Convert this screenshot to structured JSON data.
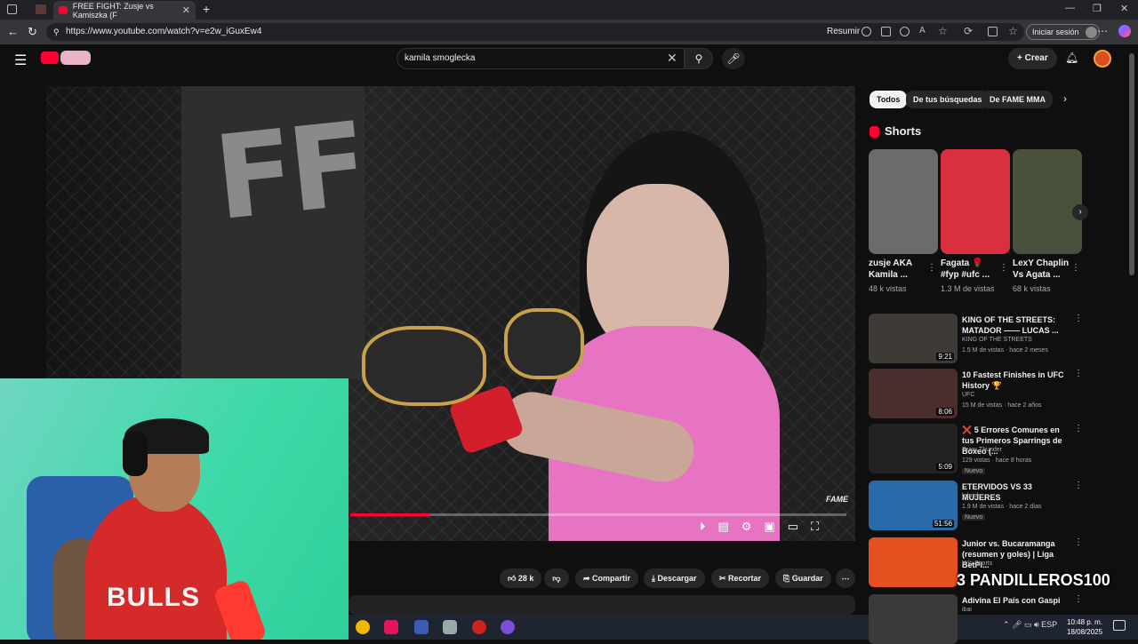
{
  "browser": {
    "tab_title": "FREE FIGHT: Zusje vs Kamiszka (F",
    "url": "https://www.youtube.com/watch?v=e2w_iGuxEw4",
    "resumir": "Resumir",
    "sign_in": "Iniciar sesión"
  },
  "header": {
    "search_value": "kamila smoglecka",
    "crear": "Crear"
  },
  "video": {
    "watermark": "FAME",
    "banner_text": "FF",
    "progress_fraction": 0.16
  },
  "actions": {
    "likes": "28 k",
    "share": "Compartir",
    "download": "Descargar",
    "clip": "Recortar",
    "save": "Guardar"
  },
  "webcam": {
    "jersey_text": "BULLS"
  },
  "chips": [
    "Todos",
    "De tus búsquedas",
    "De FAME MMA"
  ],
  "shorts": {
    "title": "Shorts",
    "items": [
      {
        "title": "zusje AKA Kamila ...",
        "views": "48 k vistas",
        "color": "#6b6b6b"
      },
      {
        "title": "Fagata 🌹 #fyp #ufc ...",
        "views": "1.3 M de vistas",
        "color": "#d8303e"
      },
      {
        "title": "LexY Chaplin Vs Agata ...",
        "views": "68 k vistas",
        "color": "#49503c"
      }
    ]
  },
  "recommended": [
    {
      "title": "KING OF THE STREETS: MATADOR —— LUCAS ...",
      "channel": "KING OF THE STREETS",
      "meta": "1.5 M de vistas · hace 2 meses",
      "duration": "9:21",
      "badge": "",
      "color": "#3e3a36"
    },
    {
      "title": "10 Fastest Finishes in UFC History 🏆",
      "channel": "UFC",
      "meta": "15 M de vistas · hace 2 años",
      "duration": "8:06",
      "badge": "",
      "color": "#4a2e2e"
    },
    {
      "title": "❌ 5 Errores Comunes en tus Primeros Sparrings de Boxeo (...",
      "channel": "Team Thunder",
      "meta": "129 vistas · hace 8 horas",
      "duration": "5:09",
      "badge": "Nuevo",
      "color": "#222"
    },
    {
      "title": "ETERVIDOS VS 33 MUJERES",
      "channel": "lebrish",
      "meta": "1.9 M de vistas · hace 2 días",
      "duration": "51:56",
      "badge": "Nuevo",
      "color": "#2a6aa8"
    },
    {
      "title": "Junior vs. Bucaramanga (resumen y goles) | Liga BetPl...",
      "channel": "Win Sports",
      "meta": "",
      "duration": "",
      "badge": "",
      "color": "#e5501e"
    },
    {
      "title": "Adivina El País con Gaspi",
      "channel": "ibai",
      "meta": "",
      "duration": "",
      "badge": "",
      "color": "#3a3a3a"
    }
  ],
  "overlay_text": "3 PANDILLEROS100",
  "taskbar": {
    "language": "ESP",
    "time": "10:48 p. m.",
    "date": "18/08/2025"
  }
}
